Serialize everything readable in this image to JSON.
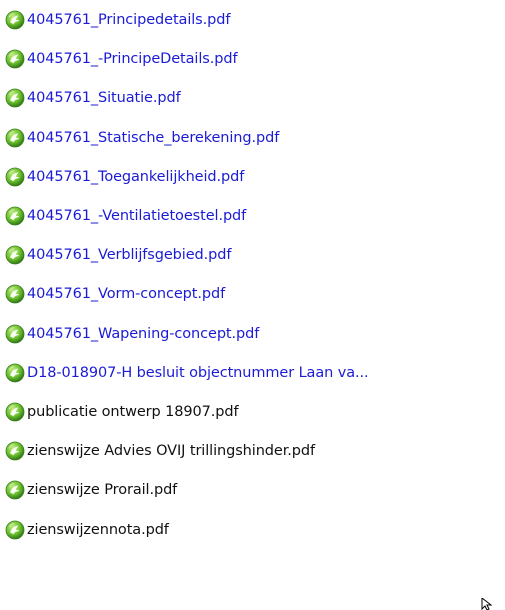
{
  "files": [
    {
      "name": "4045761_Principedetails.pdf",
      "style": "link"
    },
    {
      "name": "4045761_-PrincipeDetails.pdf",
      "style": "link"
    },
    {
      "name": "4045761_Situatie.pdf",
      "style": "link"
    },
    {
      "name": "4045761_Statische_berekening.pdf",
      "style": "link"
    },
    {
      "name": "4045761_Toegankelijkheid.pdf",
      "style": "link"
    },
    {
      "name": "4045761_-Ventilatietoestel.pdf",
      "style": "link"
    },
    {
      "name": "4045761_Verblijfsgebied.pdf",
      "style": "link"
    },
    {
      "name": "4045761_Vorm-concept.pdf",
      "style": "link"
    },
    {
      "name": "4045761_Wapening-concept.pdf",
      "style": "link"
    },
    {
      "name": "D18-018907-H besluit objectnummer Laan va...",
      "style": "link"
    },
    {
      "name": "publicatie ontwerp 18907.pdf",
      "style": "plain"
    },
    {
      "name": "zienswijze Advies OVIJ trillingshinder.pdf",
      "style": "plain"
    },
    {
      "name": "zienswijze Prorail.pdf",
      "style": "plain"
    },
    {
      "name": "zienswijzennota.pdf",
      "style": "plain"
    }
  ],
  "icon": "pdf-reader-icon",
  "colors": {
    "link_text": "#1b1bd6",
    "plain_text": "#111111",
    "icon_green": "#5fae2b",
    "icon_dark_green": "#2f7a16",
    "background": "#ffffff"
  }
}
